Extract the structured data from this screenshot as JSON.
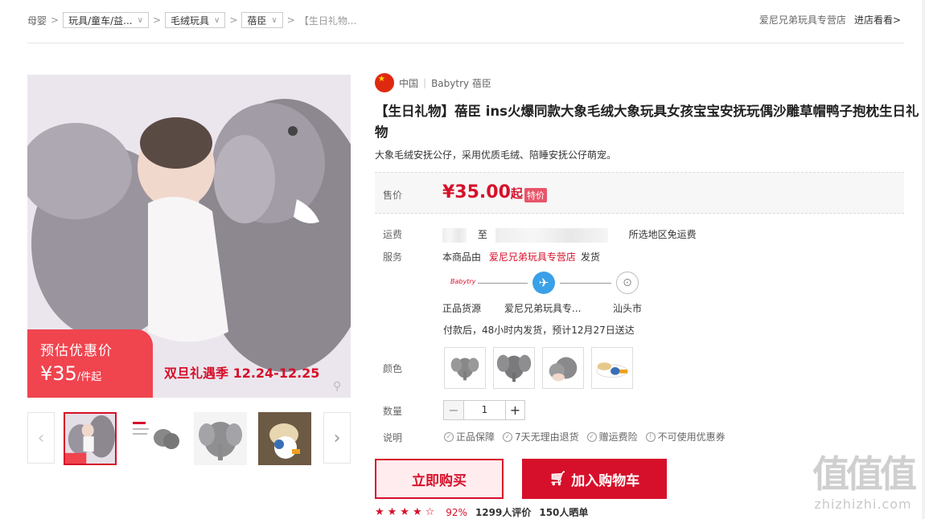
{
  "breadcrumb": {
    "root": "母婴",
    "level1": "玩具/童车/益...",
    "level2": "毛绒玩具",
    "level3": "蓓臣",
    "current": "【生日礼物..."
  },
  "shop": {
    "name": "爱尼兄弟玩具专营店",
    "enter": "进店看看>"
  },
  "promo": {
    "estimate_label": "预估优惠价",
    "price": "¥35",
    "unit": "/件起",
    "event": "双旦礼遇季 12.24-12.25"
  },
  "product": {
    "origin": "中国",
    "brand": "Babytry 蓓臣",
    "title": "【生日礼物】蓓臣 ins火爆同款大象毛绒大象玩具女孩宝宝安抚玩偶沙雕草帽鸭子抱枕生日礼物",
    "subtitle": "大象毛绒安抚公仔，采用优质毛绒、陪睡安抚公仔萌宠。"
  },
  "price": {
    "label": "售价",
    "amount": "¥35.00",
    "suffix": "起",
    "tag": "特价"
  },
  "shipping": {
    "label": "运费",
    "to": "至",
    "free_note": "所选地区免运费"
  },
  "service": {
    "label": "服务",
    "prefix": "本商品由",
    "shop": "爱尼兄弟玩具专营店",
    "suffix": "发货",
    "brand_mark": "Babytry",
    "route_from": "正品货源",
    "route_mid": "爱尼兄弟玩具专...",
    "route_to": "汕头市",
    "delivery": "付款后，48小时内发货，预计12月27日送达"
  },
  "color": {
    "label": "颜色"
  },
  "quantity": {
    "label": "数量",
    "value": "1",
    "minus": "−",
    "plus": "+"
  },
  "notes": {
    "label": "说明",
    "items": [
      "正品保障",
      "7天无理由退货",
      "赠运费险",
      "不可使用优惠券"
    ]
  },
  "actions": {
    "buy": "立即购买",
    "cart": "加入购物车"
  },
  "rating": {
    "stars": 4.5,
    "percent": "92%",
    "reviews": "1299人评价",
    "shows": "150人晒单"
  },
  "watermark": {
    "logo": "值值值",
    "url": "zhizhizhi.com"
  },
  "colors_accent": {
    "brand_red": "#d6102a",
    "promo_red": "#f0444f"
  }
}
